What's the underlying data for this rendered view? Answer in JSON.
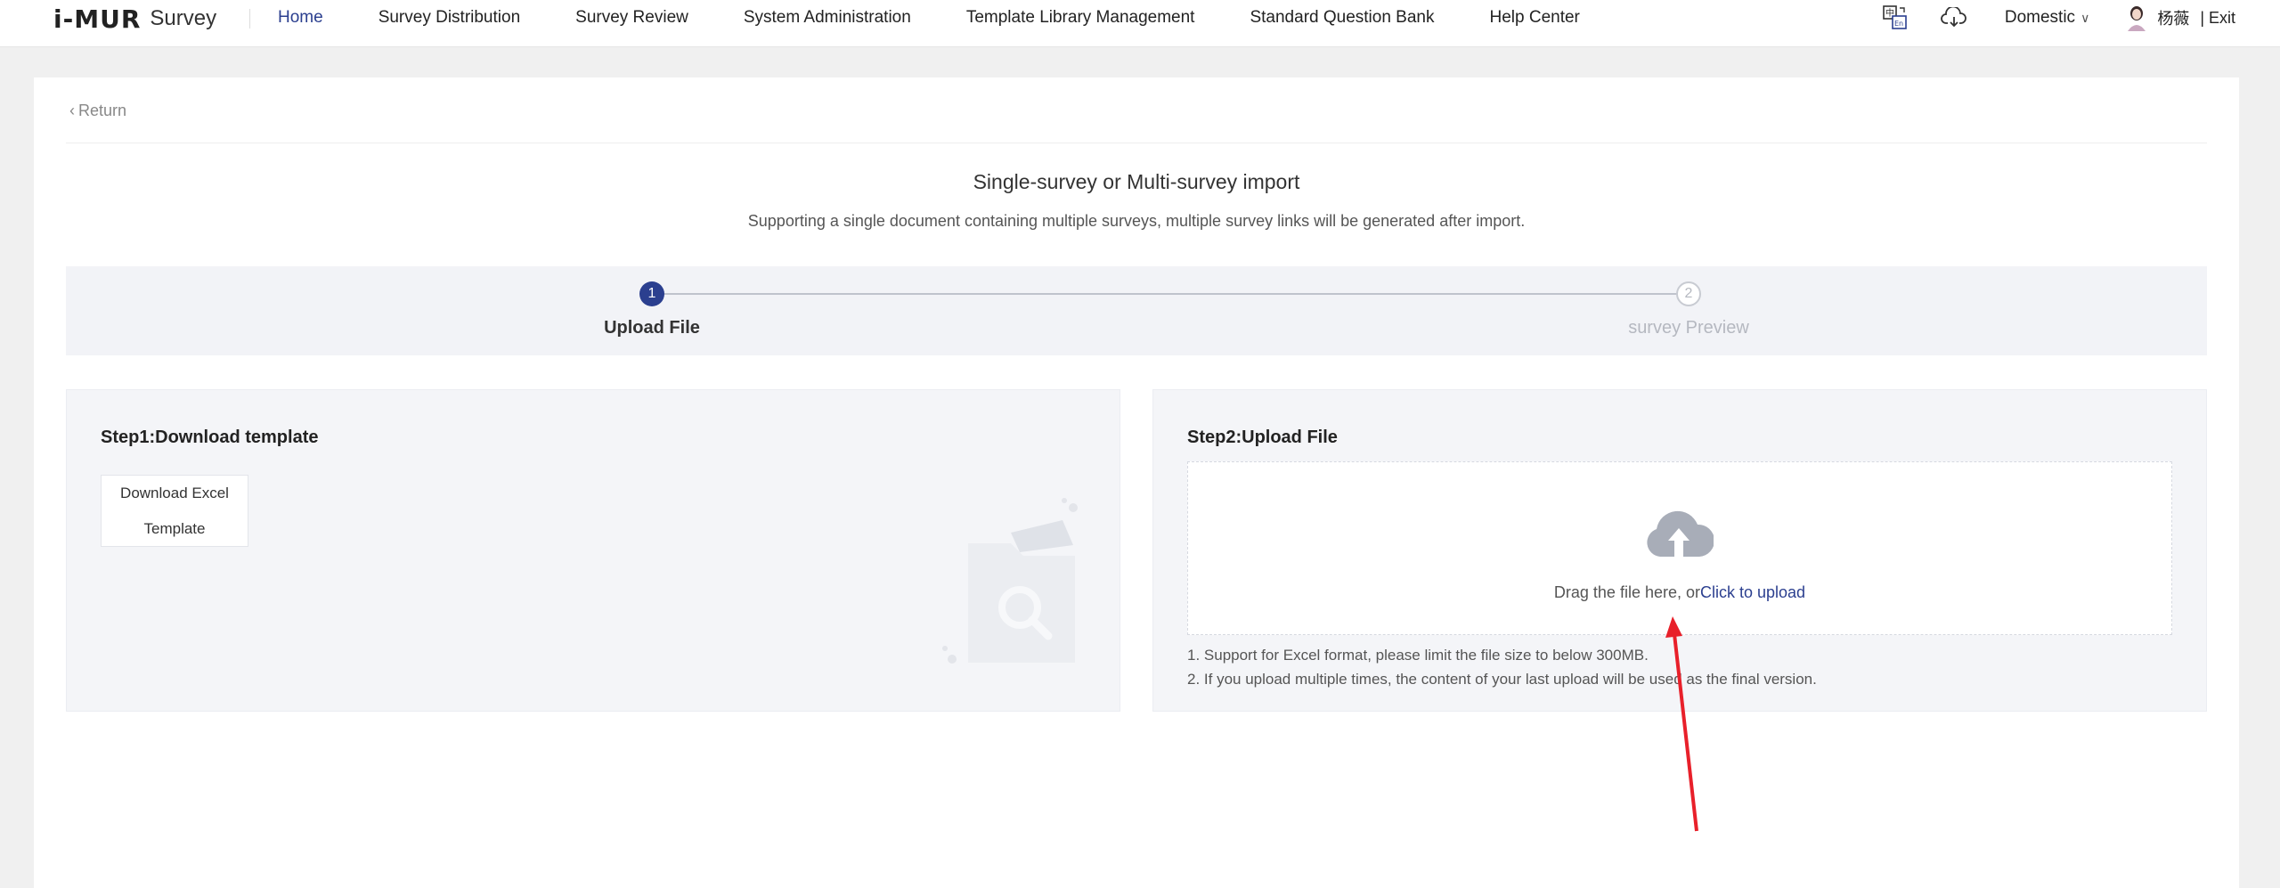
{
  "app": {
    "logo_mark": "i-MUR",
    "logo_text": "Survey"
  },
  "nav": {
    "items": [
      {
        "label": "Home",
        "active": true
      },
      {
        "label": "Survey Distribution"
      },
      {
        "label": "Survey Review"
      },
      {
        "label": "System Administration"
      },
      {
        "label": "Template Library Management"
      },
      {
        "label": "Standard Question Bank"
      },
      {
        "label": "Help Center"
      }
    ]
  },
  "header_tools": {
    "translate_icon": "translate-icon",
    "download_icon": "cloud-download-icon",
    "region": "Domestic",
    "user": "杨薇",
    "exit_label": "| Exit"
  },
  "page": {
    "return_label": "Return",
    "title": "Single-survey or Multi-survey import",
    "subtitle": "Supporting a single document containing multiple surveys, multiple survey links will be generated after import."
  },
  "steps": [
    {
      "number": "1",
      "label": "Upload File",
      "state": "active"
    },
    {
      "number": "2",
      "label": "survey Preview",
      "state": "inactive"
    }
  ],
  "left_panel": {
    "title": "Step1:Download template",
    "button_line1": "Download Excel",
    "button_line2": "Template"
  },
  "right_panel": {
    "title": "Step2:Upload File",
    "drop_text": "Drag the file here, or",
    "upload_link": "Click to upload",
    "note1": "1. Support for Excel format, please limit the file size to below 300MB.",
    "note2": "2. If you upload multiple times, the content of your last upload will be used as the final version."
  },
  "colors": {
    "accent": "#2b3f8f",
    "annotation_arrow": "#e8202a"
  }
}
